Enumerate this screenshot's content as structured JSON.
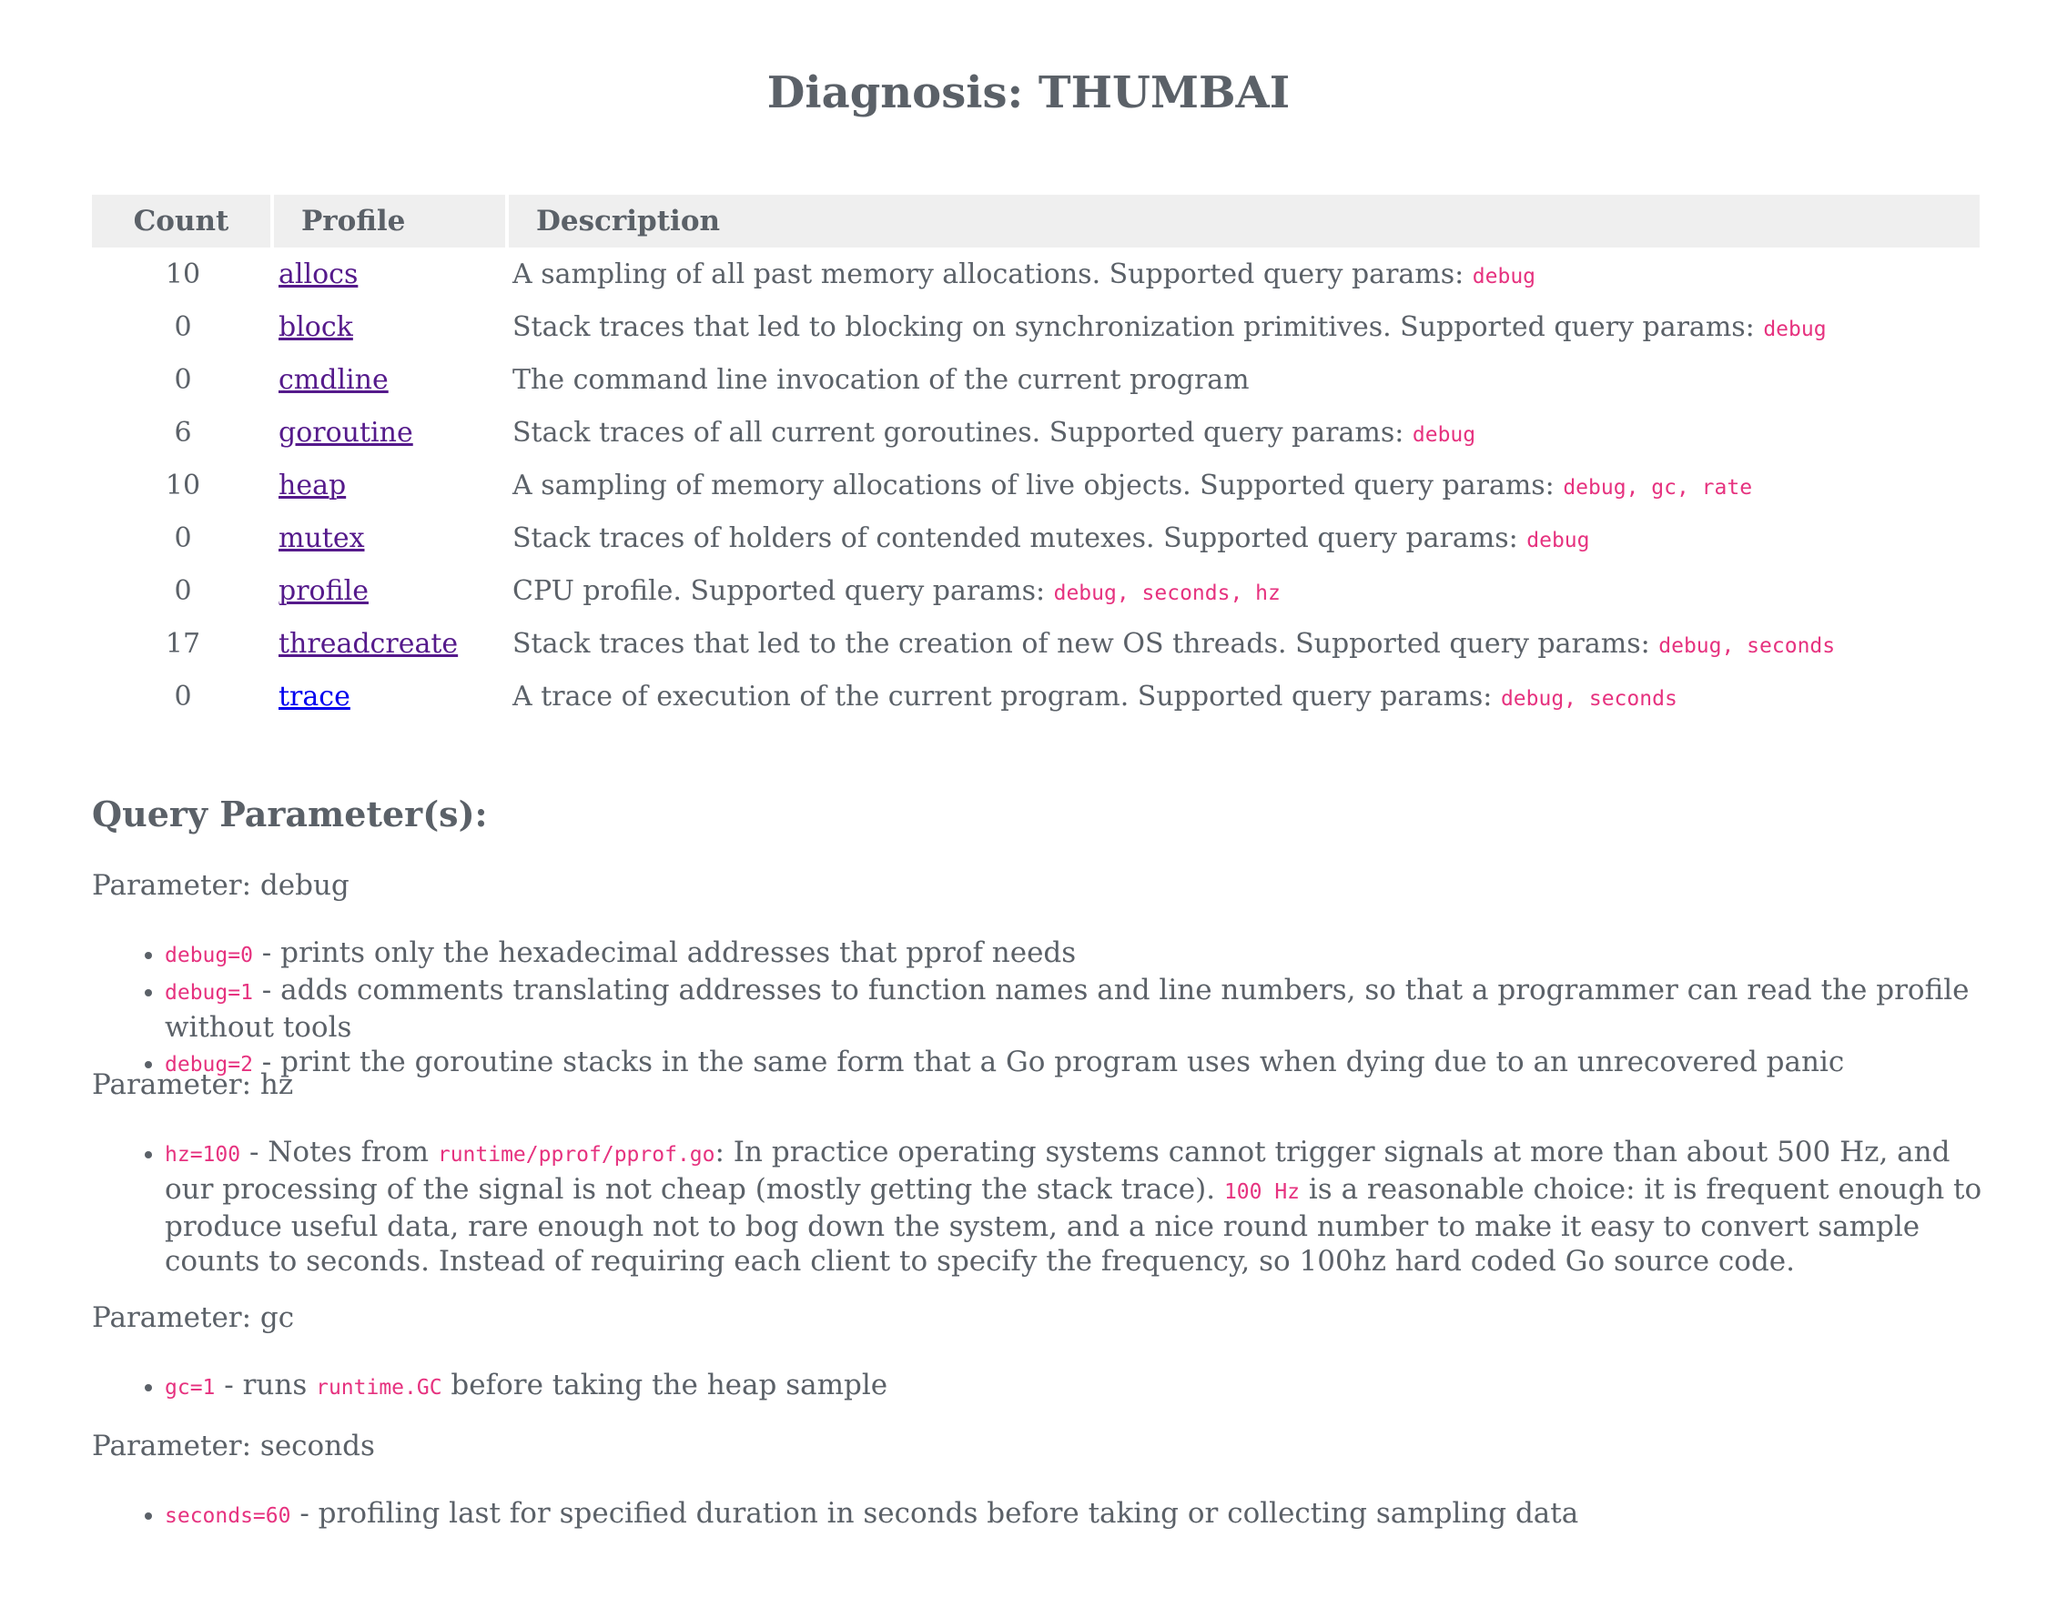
{
  "title": "Diagnosis: THUMBAI",
  "table": {
    "headers": {
      "count": "Count",
      "profile": "Profile",
      "description": "Description"
    },
    "rows": [
      {
        "count": "10",
        "profile": "allocs",
        "desc": "A sampling of all past memory allocations. Supported query params: ",
        "params": "debug"
      },
      {
        "count": "0",
        "profile": "block",
        "desc": "Stack traces that led to blocking on synchronization primitives. Supported query params: ",
        "params": "debug"
      },
      {
        "count": "0",
        "profile": "cmdline",
        "desc": "The command line invocation of the current program",
        "params": ""
      },
      {
        "count": "6",
        "profile": "goroutine",
        "desc": "Stack traces of all current goroutines. Supported query params: ",
        "params": "debug"
      },
      {
        "count": "10",
        "profile": "heap",
        "desc": "A sampling of memory allocations of live objects. Supported query params: ",
        "params": "debug, gc, rate"
      },
      {
        "count": "0",
        "profile": "mutex",
        "desc": "Stack traces of holders of contended mutexes. Supported query params: ",
        "params": "debug"
      },
      {
        "count": "0",
        "profile": "profile",
        "desc": "CPU profile. Supported query params: ",
        "params": "debug, seconds, hz"
      },
      {
        "count": "17",
        "profile": "threadcreate",
        "desc": "Stack traces that led to the creation of new OS threads. Supported query params: ",
        "params": "debug, seconds"
      },
      {
        "count": "0",
        "profile": "trace",
        "desc": "A trace of execution of the current program. Supported query params: ",
        "params": "debug, seconds"
      }
    ]
  },
  "query": {
    "heading": "Query Parameter(s):",
    "debug": {
      "title": "Parameter: debug",
      "items": [
        {
          "code": "debug=0",
          "text": " - prints only the hexadecimal addresses that pprof needs"
        },
        {
          "code": "debug=1",
          "text": " - adds comments translating addresses to function names and line numbers, so that a programmer can read the profile without tools"
        },
        {
          "code": "debug=2",
          "text": " - print the goroutine stacks in the same form that a Go program uses when dying due to an unrecovered panic"
        }
      ]
    },
    "hz": {
      "title": "Parameter: hz",
      "code": "hz=100",
      "text1": " - Notes from ",
      "code2": "runtime/pprof/pprof.go",
      "text2": ": In practice operating systems cannot trigger signals at more than about 500 Hz, and our processing of the signal is not cheap (mostly getting the stack trace). ",
      "code3": "100 Hz",
      "text3": " is a reasonable choice: it is frequent enough to produce useful data, rare enough not to bog down the system, and a nice round number to make it easy to convert sample counts to seconds. Instead of requiring each client to specify the frequency, so 100hz hard coded Go source code."
    },
    "gc": {
      "title": "Parameter: gc",
      "code": "gc=1",
      "text1": " - runs ",
      "code2": "runtime.GC",
      "text2": " before taking the heap sample"
    },
    "seconds": {
      "title": "Parameter: seconds",
      "code": "seconds=60",
      "text": " - profiling last for specified duration in seconds before taking or collecting sampling data"
    }
  }
}
